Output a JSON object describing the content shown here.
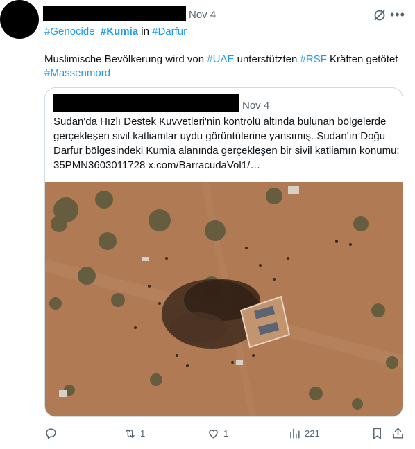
{
  "post": {
    "time": "Nov 4",
    "hashtags": [
      {
        "text": "#Genocide"
      },
      {
        "text": "#Kumia"
      },
      {
        "text": "in"
      },
      {
        "text": "#Darfur"
      }
    ],
    "body_parts": [
      "Muslimische Bevölkerung wird von ",
      "#UAE",
      " unterstützten ",
      "#RSF",
      " Kräften getötet ",
      "#Massenmord"
    ]
  },
  "quote": {
    "time": "Nov 4",
    "text": "Sudan'da Hızlı Destek Kuvvetleri'nin kontrolü altında bulunan bölgelerde gerçekleşen sivil katliamlar uydu görüntülerine yansımış. Sudan'ın Doğu Darfur bölgesindeki Kumia alanında gerçekleşen bir sivil katliamın konumu: 35PMN3603011728  x.com/BarracudaVol1/…",
    "image_icon": "satellite-photo"
  },
  "actions": {
    "reply": {
      "icon": "reply-icon",
      "count": ""
    },
    "repost": {
      "icon": "repost-icon",
      "count": "1"
    },
    "like": {
      "icon": "heart-icon",
      "count": "1"
    },
    "views": {
      "icon": "views-icon",
      "count": "221"
    },
    "bookmark": {
      "icon": "bookmark-icon"
    },
    "share": {
      "icon": "share-icon"
    }
  },
  "colors": {
    "link": "#1d9bf0",
    "muted": "#536471",
    "ground": "#b07a55"
  }
}
